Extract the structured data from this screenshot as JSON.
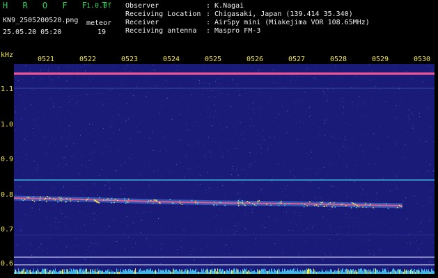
{
  "header": {
    "brand": "H R O F F T",
    "version": "1.0.0f",
    "filename": "KN9_2505200520.png",
    "datetime": "25.05.20 05:20",
    "meteor_label": "meteor",
    "meteor_count": "19",
    "info": [
      {
        "label": "Observer",
        "value": ": K.Nagai"
      },
      {
        "label": "Receiving Location",
        "value": ": Chigasaki, Japan (139.414 35.340)"
      },
      {
        "label": "Receiver",
        "value": ": AirSpy mini (Miakejima VOR 108.65MHz)"
      },
      {
        "label": "Receiving antenna",
        "value": ": Maspro FM-3"
      }
    ]
  },
  "axis": {
    "unit": "kHz",
    "time_ticks": [
      "0521",
      "0522",
      "0523",
      "0524",
      "0525",
      "0526",
      "0527",
      "0528",
      "0529",
      "0530"
    ],
    "freq_ticks": [
      "1.1",
      "1.0",
      "0.9",
      "0.8",
      "0.7",
      "0.6"
    ]
  },
  "colors": {
    "background": "#1a1a78",
    "header_text": "#f4e94a",
    "brand": "#2fd05a",
    "signal": "#e05a8c",
    "cyan_line": "#3fd0e0"
  }
}
